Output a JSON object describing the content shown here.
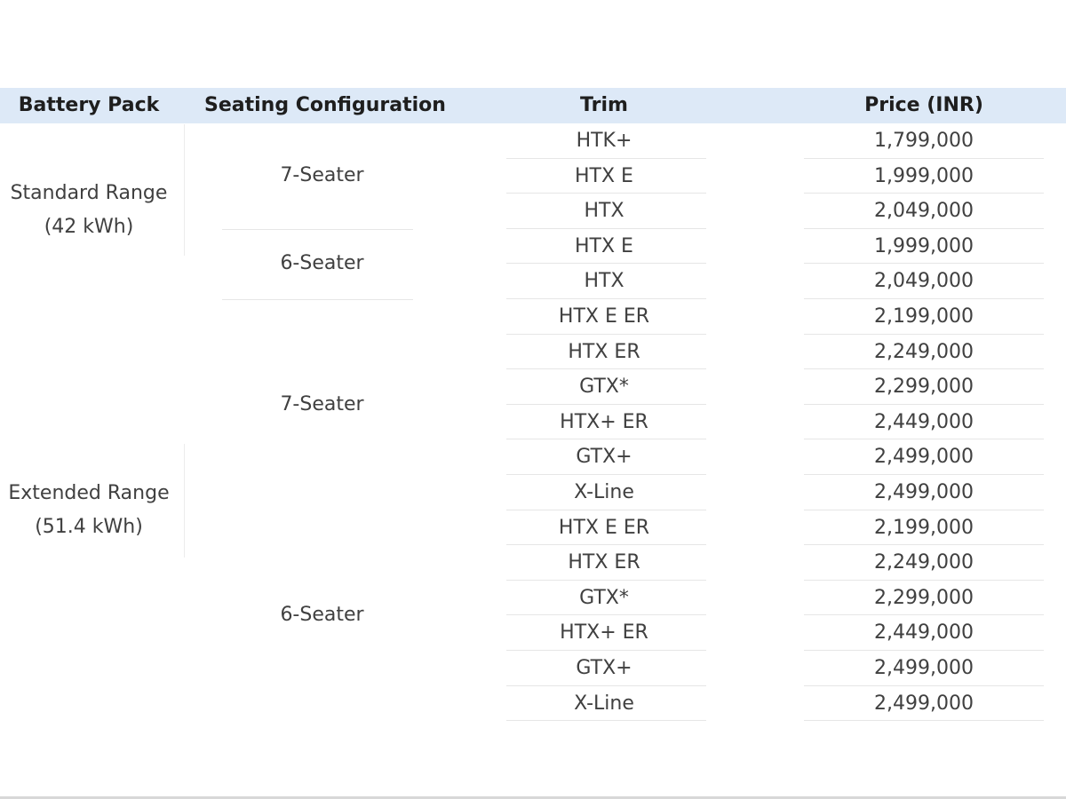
{
  "table": {
    "headers": {
      "battery_pack": "Battery Pack",
      "seating": "Seating Configuration",
      "trim": "Trim",
      "price": "Price (INR)"
    },
    "battery_packs": [
      {
        "name": "Standard Range",
        "capacity": "(42 kWh)"
      },
      {
        "name": "Extended Range",
        "capacity": "(51.4 kWh)"
      }
    ],
    "seating_groups": [
      {
        "label": "7-Seater"
      },
      {
        "label": "6-Seater"
      },
      {
        "label": "7-Seater"
      },
      {
        "label": "6-Seater"
      }
    ],
    "rows": [
      {
        "trim": "HTK+",
        "price": "1,799,000"
      },
      {
        "trim": "HTX E",
        "price": "1,999,000"
      },
      {
        "trim": "HTX",
        "price": "2,049,000"
      },
      {
        "trim": "HTX E",
        "price": "1,999,000"
      },
      {
        "trim": "HTX",
        "price": "2,049,000"
      },
      {
        "trim": "HTX E ER",
        "price": "2,199,000"
      },
      {
        "trim": "HTX ER",
        "price": "2,249,000"
      },
      {
        "trim": "GTX*",
        "price": "2,299,000"
      },
      {
        "trim": "HTX+ ER",
        "price": "2,449,000"
      },
      {
        "trim": "GTX+",
        "price": "2,499,000"
      },
      {
        "trim": "X-Line",
        "price": "2,499,000"
      },
      {
        "trim": "HTX E ER",
        "price": "2,199,000"
      },
      {
        "trim": "HTX ER",
        "price": "2,249,000"
      },
      {
        "trim": "GTX*",
        "price": "2,299,000"
      },
      {
        "trim": "HTX+ ER",
        "price": "2,449,000"
      },
      {
        "trim": "GTX+",
        "price": "2,499,000"
      },
      {
        "trim": "X-Line",
        "price": "2,499,000"
      }
    ]
  }
}
